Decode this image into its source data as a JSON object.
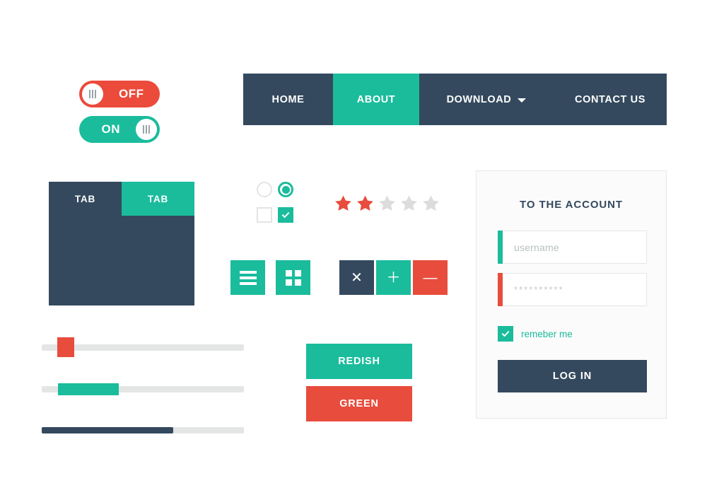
{
  "colors": {
    "green": "#1abc9c",
    "red": "#e74c3c",
    "red_toggle": "#ec4a3b",
    "navy": "#34495e",
    "track": "#e4e6e6",
    "star_empty": "#dcdcdc"
  },
  "toggles": [
    {
      "name": "off-toggle",
      "label": "OFF",
      "state": "off",
      "color": "#ec4a3b"
    },
    {
      "name": "on-toggle",
      "label": "ON",
      "state": "on",
      "color": "#1abc9c"
    }
  ],
  "navbar": {
    "items": [
      {
        "label": "HOME",
        "active": false,
        "has_caret": false
      },
      {
        "label": "ABOUT",
        "active": true,
        "has_caret": false
      },
      {
        "label": "DOWNLOAD",
        "active": false,
        "has_caret": true
      },
      {
        "label": "CONTACT US",
        "active": false,
        "has_caret": false
      }
    ]
  },
  "tabpanel": {
    "tabs": [
      {
        "label": "TAB",
        "active": false
      },
      {
        "label": "TAB",
        "active": true
      }
    ]
  },
  "choices": {
    "radio_unselected": "radio-unchecked-icon",
    "radio_selected": "radio-checked-icon",
    "checkbox_unchecked": "checkbox-unchecked-icon",
    "checkbox_checked": "checkbox-checked-icon"
  },
  "rating": {
    "value": 2,
    "max": 5,
    "filled_color": "#e74c3c",
    "empty_color": "#dcdcdc"
  },
  "view_buttons": [
    {
      "name": "list-view-button",
      "icon": "hamburger-icon",
      "color": "#1abc9c"
    },
    {
      "name": "grid-view-button",
      "icon": "grid-icon",
      "color": "#1abc9c"
    }
  ],
  "action_buttons": [
    {
      "name": "close-button",
      "icon": "close-icon",
      "glyph": "✕",
      "color": "#34495e"
    },
    {
      "name": "add-button",
      "icon": "plus-icon",
      "glyph": "＋",
      "color": "#1abc9c"
    },
    {
      "name": "remove-button",
      "icon": "minus-icon",
      "glyph": "—",
      "color": "#e74c3c"
    }
  ],
  "sliders": [
    {
      "name": "square-handle-slider",
      "type": "handle",
      "value_pct": 11,
      "handle_color": "#e74c3c"
    },
    {
      "name": "range-slider",
      "type": "range",
      "start_pct": 8,
      "end_pct": 38,
      "fill_color": "#1abc9c"
    },
    {
      "name": "progress-slider",
      "type": "fill",
      "value_pct": 65,
      "fill_color": "#34495e"
    }
  ],
  "color_buttons": [
    {
      "label": "REDISH",
      "color": "#1abc9c"
    },
    {
      "label": "GREEN",
      "color": "#e74c3c"
    }
  ],
  "login": {
    "title": "TO THE ACCOUNT",
    "username": {
      "placeholder": "username",
      "value": "",
      "accent": "#1abc9c"
    },
    "password": {
      "placeholder": "**********",
      "value": "",
      "accent": "#e74c3c"
    },
    "remember": {
      "label": "remeber me",
      "checked": true
    },
    "submit_label": "LOG IN"
  }
}
